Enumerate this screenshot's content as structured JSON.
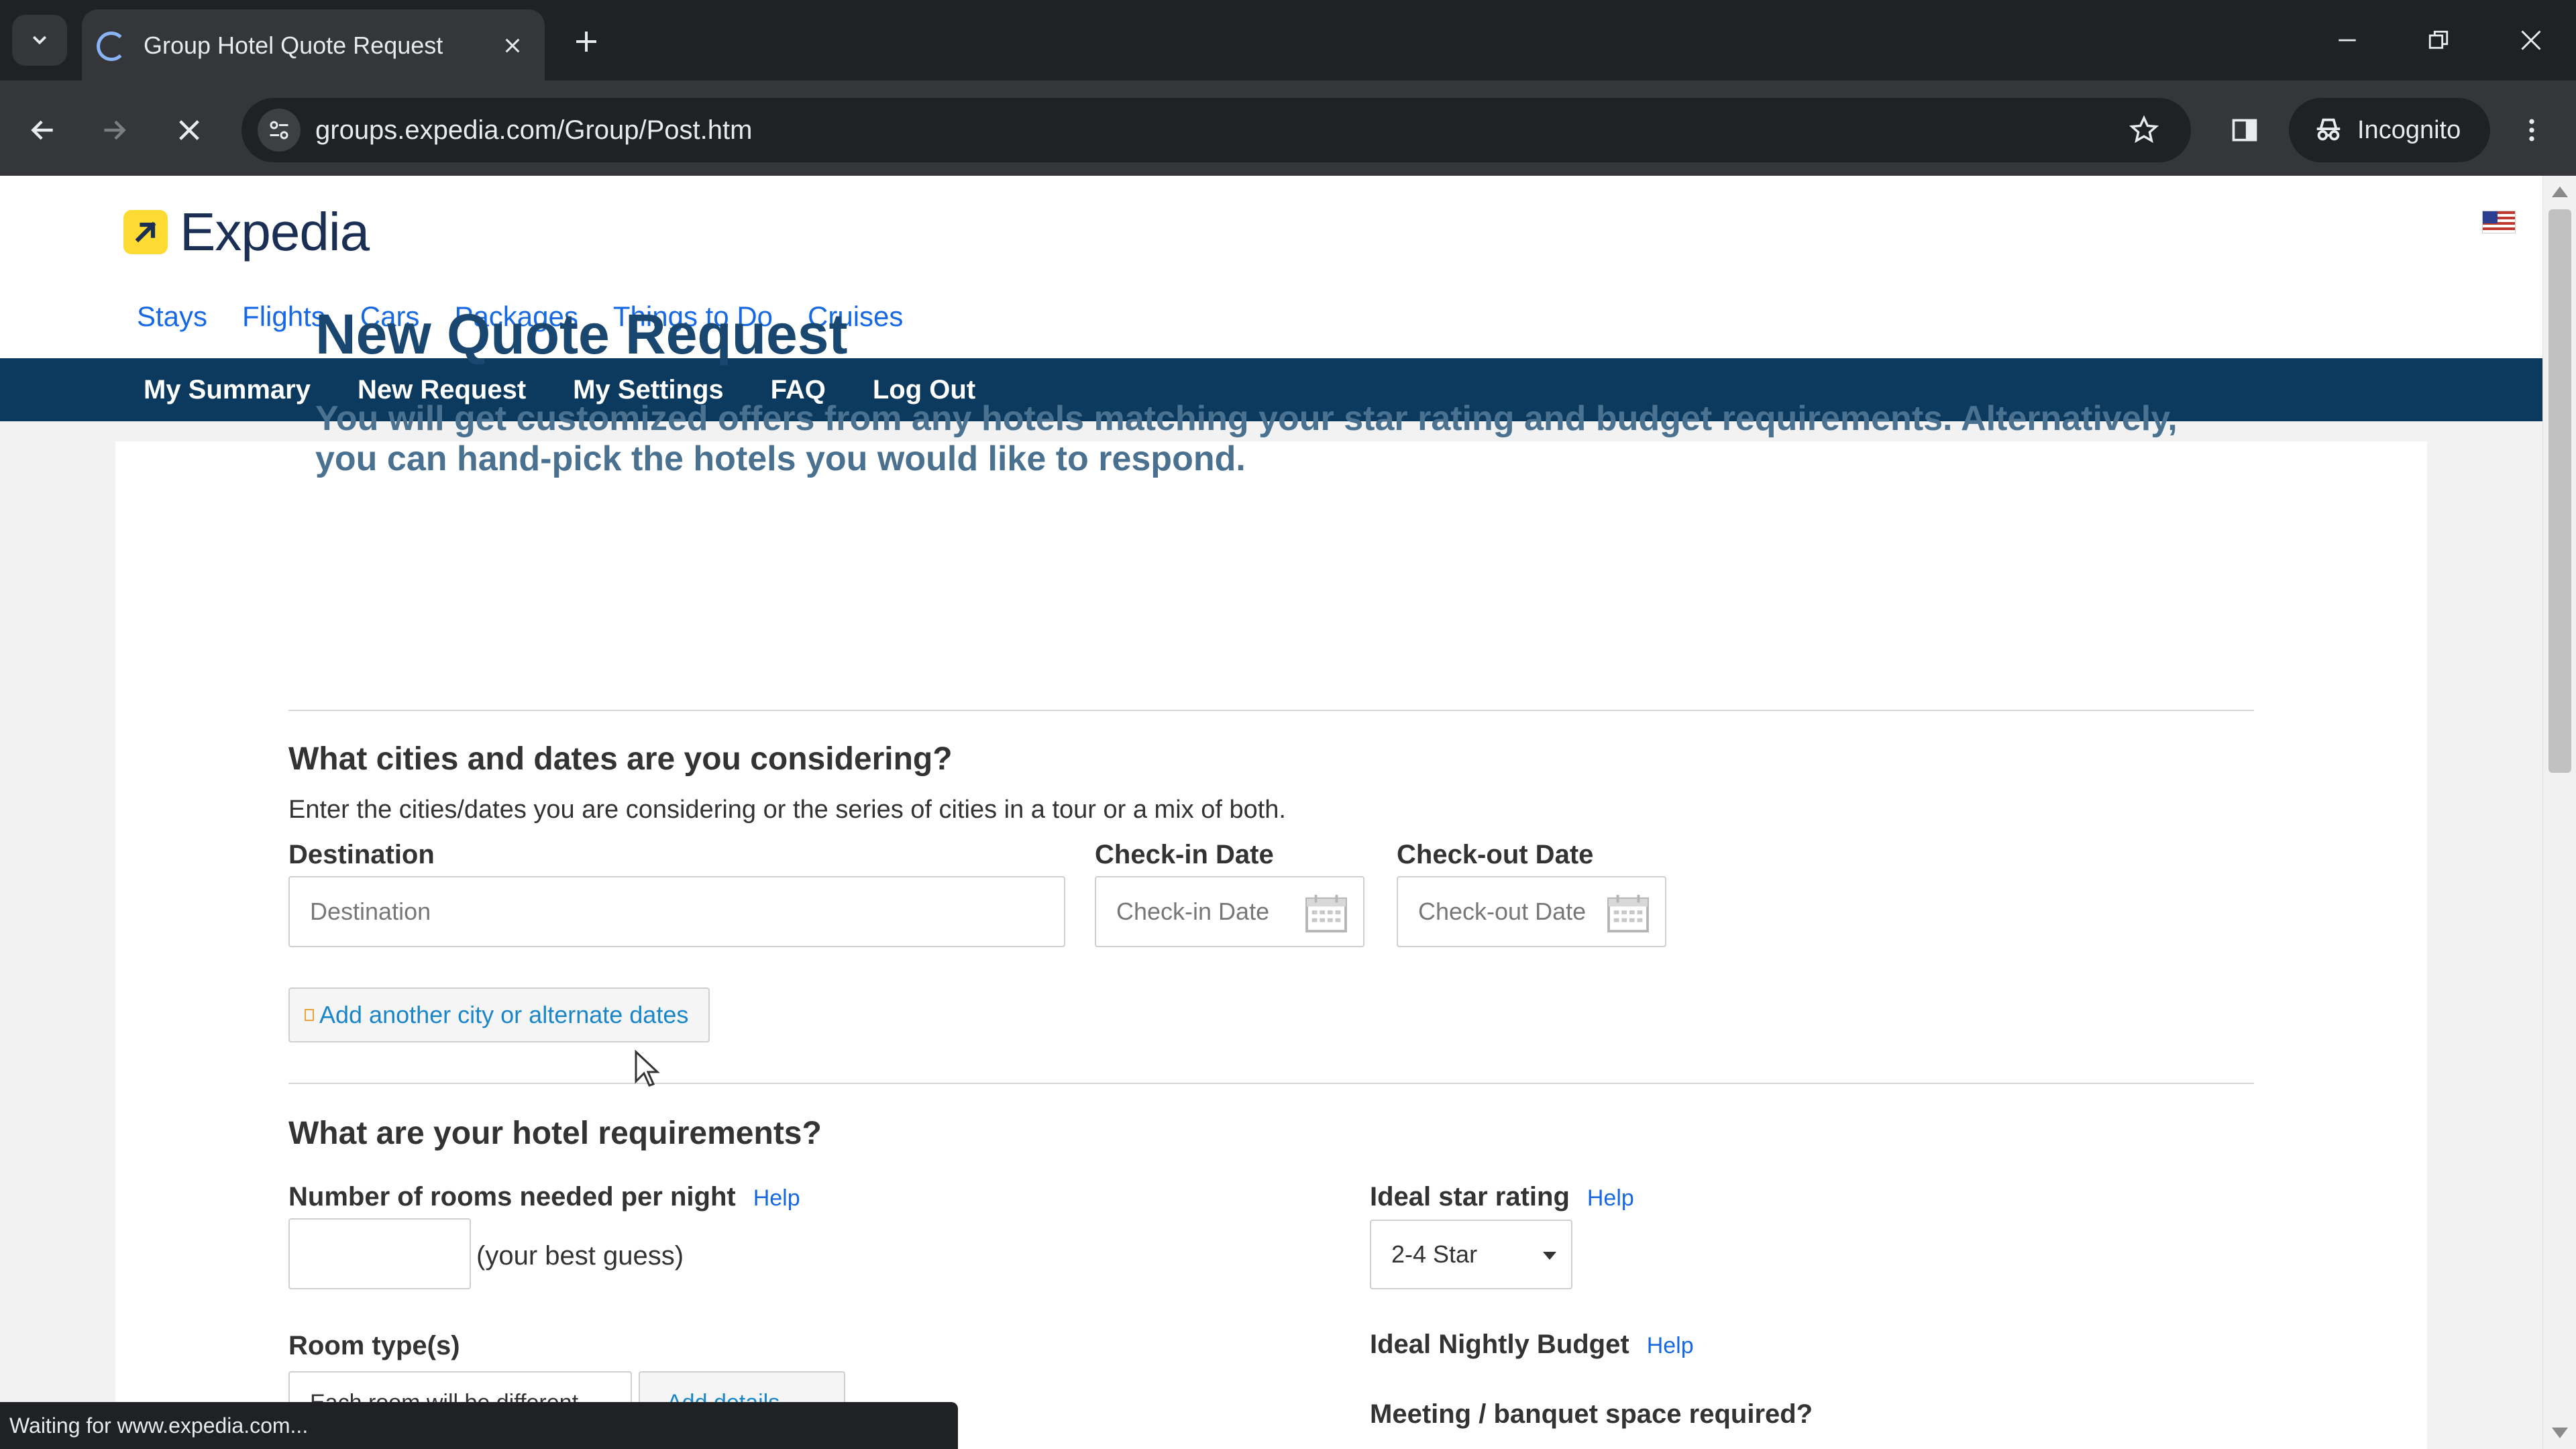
{
  "browser": {
    "tab_title": "Group Hotel Quote Request",
    "url": "groups.expedia.com/Group/Post.htm",
    "incognito_label": "Incognito",
    "status_text": "Waiting for www.expedia.com..."
  },
  "site": {
    "logo_text": "Expedia",
    "top_nav": [
      "Stays",
      "Flights",
      "Cars",
      "Packages",
      "Things to Do",
      "Cruises"
    ],
    "account_nav": [
      "My Summary",
      "New Request",
      "My Settings",
      "FAQ",
      "Log Out"
    ]
  },
  "page": {
    "title": "New Quote Request",
    "intro": "You will get customized offers from any hotels matching your star rating and budget requirements. Alternatively, you can hand-pick the hotels you would like to respond.",
    "cities_section": {
      "heading": "What cities and dates are you considering?",
      "help": "Enter the cities/dates you are considering or the series of cities in a tour or a mix of both.",
      "destination_label": "Destination",
      "destination_placeholder": "Destination",
      "checkin_label": "Check-in Date",
      "checkin_placeholder": "Check-in Date",
      "checkout_label": "Check-out Date",
      "checkout_placeholder": "Check-out Date",
      "add_city_label": "Add another city or alternate dates"
    },
    "hotel_section": {
      "heading": "What are your hotel requirements?",
      "rooms_label": "Number of rooms needed per night",
      "help_link": "Help",
      "rooms_value": "",
      "rooms_hint": "(your best guess)",
      "star_label": "Ideal star rating",
      "star_value": "2-4 Star",
      "room_types_label": "Room type(s)",
      "room_types_value": "Each room will be different",
      "add_details_label": "Add details",
      "budget_label": "Ideal Nightly Budget",
      "meeting_label": "Meeting / banquet space required?"
    }
  },
  "colors": {
    "brand_navy": "#0b3a5e",
    "link_blue": "#1668e3",
    "logo_yellow": "#fddb32",
    "title_blue": "#1a476f"
  }
}
